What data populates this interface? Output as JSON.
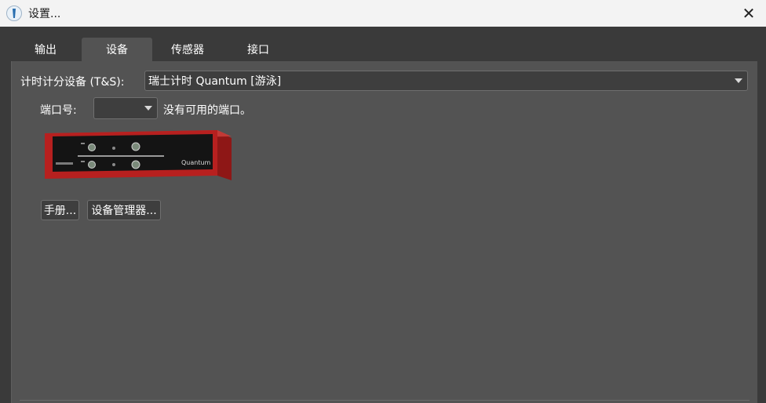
{
  "window": {
    "title": "设置...",
    "close_symbol": "✕"
  },
  "tabs": [
    {
      "label": "输出",
      "active": false
    },
    {
      "label": "设备",
      "active": true
    },
    {
      "label": "传感器",
      "active": false
    },
    {
      "label": "接口",
      "active": false
    }
  ],
  "device": {
    "timing_label": "计时计分设备 (T&S):",
    "timing_selected": "瑞士计时 Quantum [游泳]",
    "port_label": "端口号:",
    "port_selected": "",
    "port_status": "没有可用的端口。",
    "image_brand_text": "Quantum"
  },
  "buttons": {
    "manual": "手册...",
    "device_manager": "设备管理器..."
  },
  "colors": {
    "panel": "#535353",
    "background": "#3a3a3a",
    "titlebar": "#f3f3f3",
    "device_red": "#b7201f"
  },
  "icons": [
    "app-icon",
    "close-icon",
    "chevron-down-icon"
  ]
}
